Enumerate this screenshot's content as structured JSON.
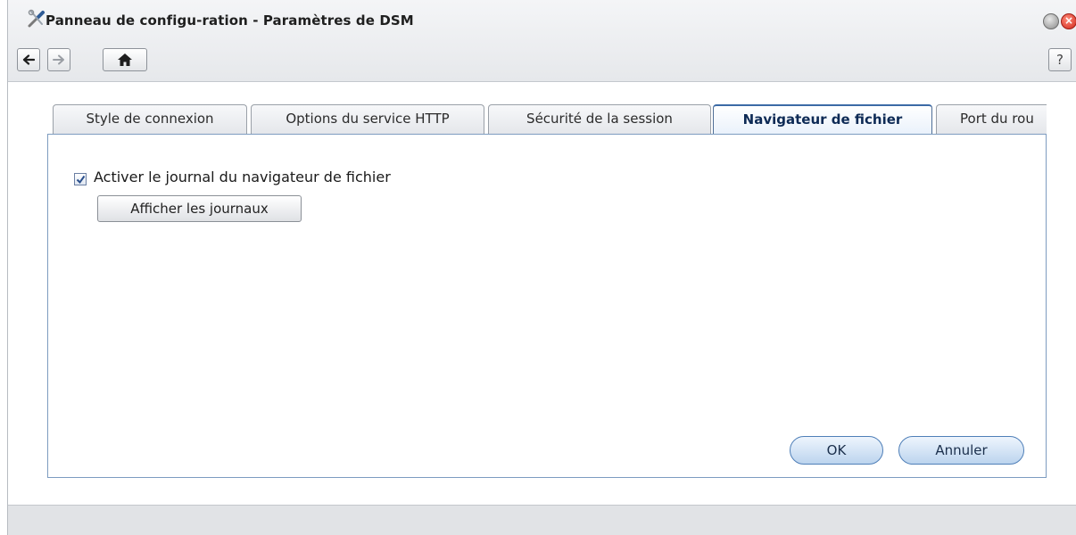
{
  "window": {
    "title": "Panneau de configu-ration - Paramètres de DSM",
    "icon": "tools-icon",
    "controls": [
      "minimize-icon",
      "close-icon"
    ]
  },
  "toolbar": {
    "back": "arrow-left-icon",
    "forward": "arrow-right-icon",
    "home": "home-icon",
    "help_label": "?"
  },
  "tabs": [
    {
      "label": "Style de connexion",
      "active": false
    },
    {
      "label": "Options du service HTTP",
      "active": false
    },
    {
      "label": "Sécurité de la session",
      "active": false
    },
    {
      "label": "Navigateur de fichier",
      "active": true
    },
    {
      "label": "Port du rou",
      "active": false
    }
  ],
  "panel": {
    "enable_log": {
      "label": "Activer le journal du navigateur de fichier",
      "checked": true
    },
    "view_logs_label": "Afficher les journaux",
    "ok_label": "OK",
    "cancel_label": "Annuler"
  },
  "colors": {
    "accent": "#3b6aa6",
    "panel_border": "#7d9cc0",
    "pill_button": "#bcd4ee"
  }
}
